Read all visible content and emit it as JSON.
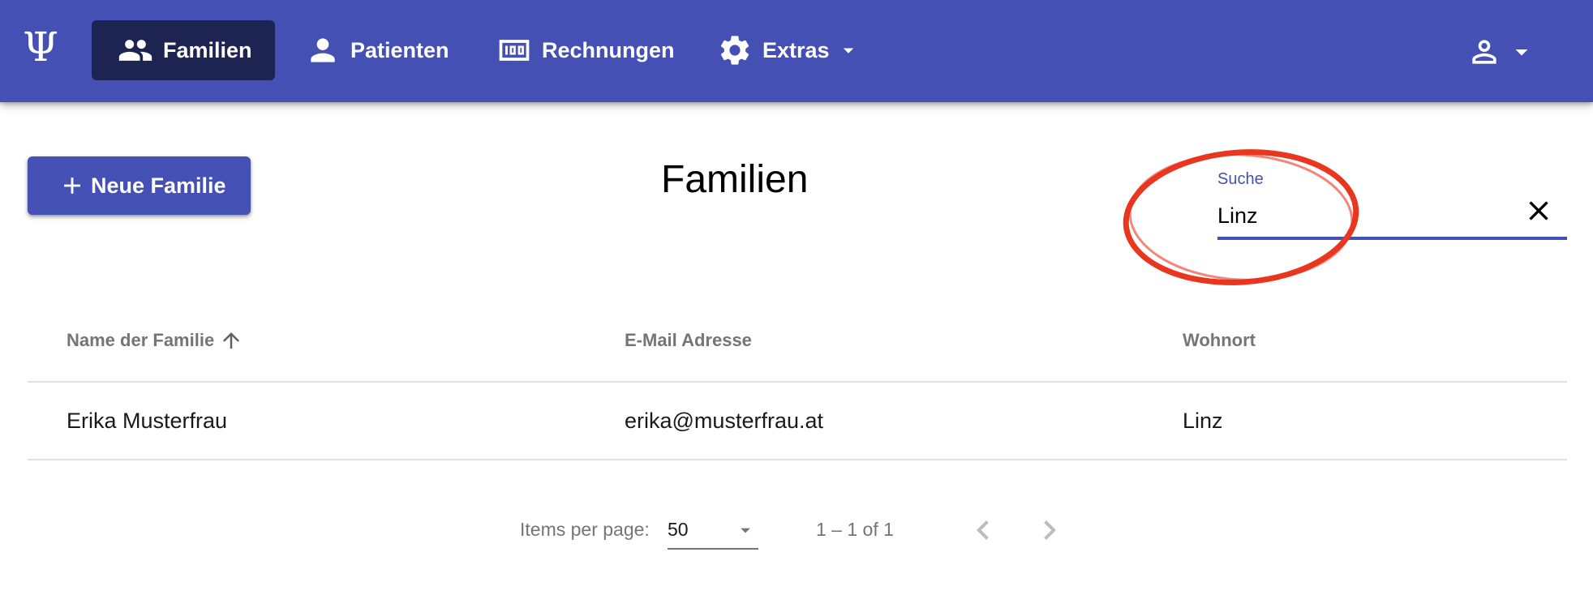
{
  "app": {
    "logo_glyph": "Ψ"
  },
  "nav": {
    "familien": "Familien",
    "patienten": "Patienten",
    "rechnungen": "Rechnungen",
    "extras": "Extras"
  },
  "page": {
    "title": "Familien",
    "new_family_button": "Neue Familie"
  },
  "search": {
    "label": "Suche",
    "value": "Linz"
  },
  "table": {
    "columns": [
      "Name der Familie",
      "E-Mail Adresse",
      "Wohnort"
    ],
    "sort": {
      "column": "Name der Familie",
      "direction": "ascending"
    },
    "rows": [
      {
        "name": "Erika Musterfrau",
        "email": "erika@musterfrau.at",
        "city": "Linz"
      }
    ]
  },
  "paginator": {
    "items_per_page_label": "Items per page:",
    "page_size": "50",
    "range": "1 – 1 of 1"
  },
  "colors": {
    "toolbar": "#4450b3",
    "active_nav": "#1e2452",
    "annotation": "#e8361f"
  },
  "icons": {
    "familien": "people-icon",
    "patienten": "person-icon",
    "rechnungen": "counter-icon",
    "extras": "gear-icon",
    "account": "account-icon",
    "clear": "close-icon",
    "sort": "arrow-up-icon"
  }
}
